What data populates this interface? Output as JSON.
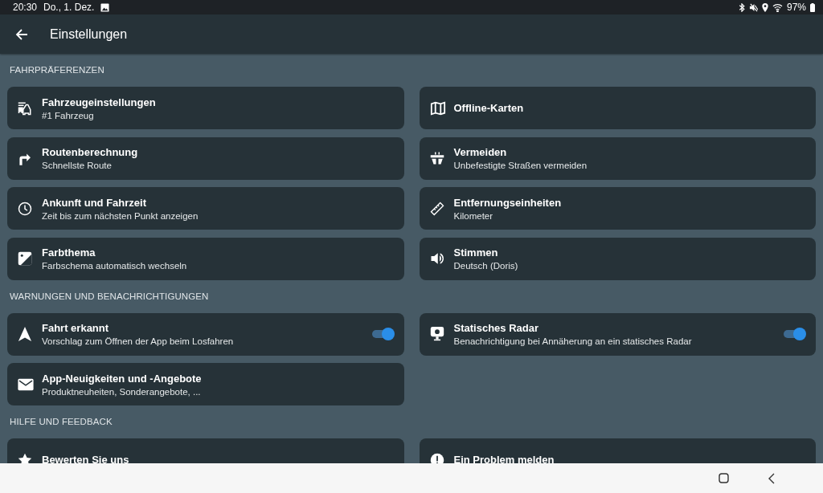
{
  "status_bar": {
    "time": "20:30",
    "date": "Do., 1. Dez.",
    "battery": "97%"
  },
  "header": {
    "title": "Einstellungen"
  },
  "sections": [
    {
      "title": "FAHRPRÄFERENZEN",
      "items": [
        {
          "kind": "link",
          "title": "Fahrzeugeinstellungen",
          "subtitle": "#1 Fahrzeug"
        },
        {
          "kind": "link",
          "title": "Offline-Karten"
        },
        {
          "kind": "link",
          "title": "Routenberechnung",
          "subtitle": "Schnellste Route"
        },
        {
          "kind": "link",
          "title": "Vermeiden",
          "subtitle": "Unbefestigte Straßen vermeiden"
        },
        {
          "kind": "link",
          "title": "Ankunft und Fahrzeit",
          "subtitle": "Zeit bis zum nächsten Punkt anzeigen"
        },
        {
          "kind": "link",
          "title": "Entfernungseinheiten",
          "subtitle": "Kilometer"
        },
        {
          "kind": "link",
          "title": "Farbthema",
          "subtitle": "Farbschema automatisch wechseln"
        },
        {
          "kind": "link",
          "title": "Stimmen",
          "subtitle": "Deutsch (Doris)"
        }
      ]
    },
    {
      "title": "WARNUNGEN UND BENACHRICHTIGUNGEN",
      "items": [
        {
          "kind": "toggle",
          "title": "Fahrt erkannt",
          "subtitle": "Vorschlag zum Öffnen der App beim Losfahren",
          "on": true
        },
        {
          "kind": "toggle",
          "title": "Statisches Radar",
          "subtitle": "Benachrichtigung bei Annäherung an ein statisches Radar",
          "on": true
        },
        {
          "kind": "link",
          "title": "App-Neuigkeiten und -Angebote",
          "subtitle": "Produktneuheiten, Sonderangebote, ..."
        }
      ]
    },
    {
      "title": "HILFE UND FEEDBACK",
      "items": [
        {
          "kind": "link",
          "title": "Bewerten Sie uns"
        },
        {
          "kind": "link",
          "title": "Ein Problem melden"
        }
      ]
    }
  ]
}
